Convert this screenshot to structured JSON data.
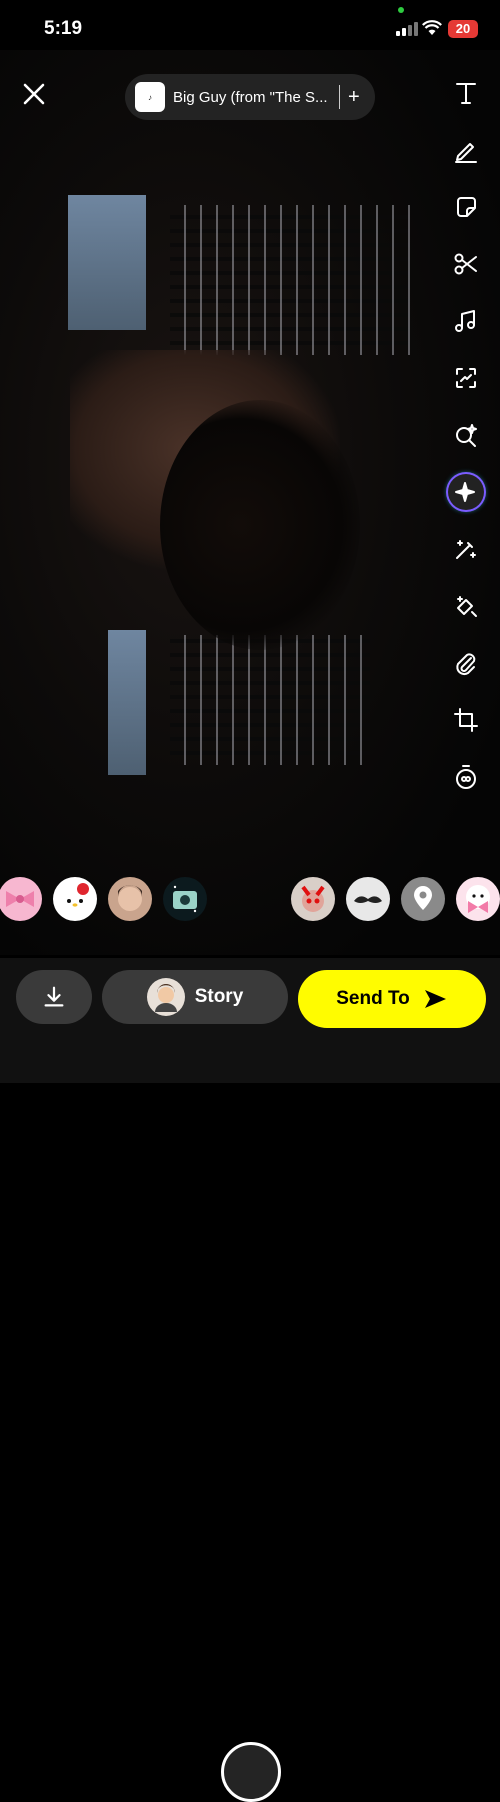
{
  "status_bar": {
    "time": "5:19",
    "battery": "20"
  },
  "sound": {
    "title": "Big Guy (from \"The S...",
    "add_label": "+"
  },
  "tools": [
    "text-tool",
    "pen-tool",
    "sticker-tool",
    "scissors-tool",
    "music-tool",
    "scan-tool",
    "search-lens-tool",
    "ai-sparkle-tool",
    "magic-wand-tool",
    "eraser-tool",
    "attachment-tool",
    "crop-tool",
    "timer-tool"
  ],
  "bottom_bar": {
    "story_label": "Story",
    "send_label": "Send To"
  },
  "colors": {
    "send_button": "#FFFC00",
    "battery": "#E53935"
  }
}
